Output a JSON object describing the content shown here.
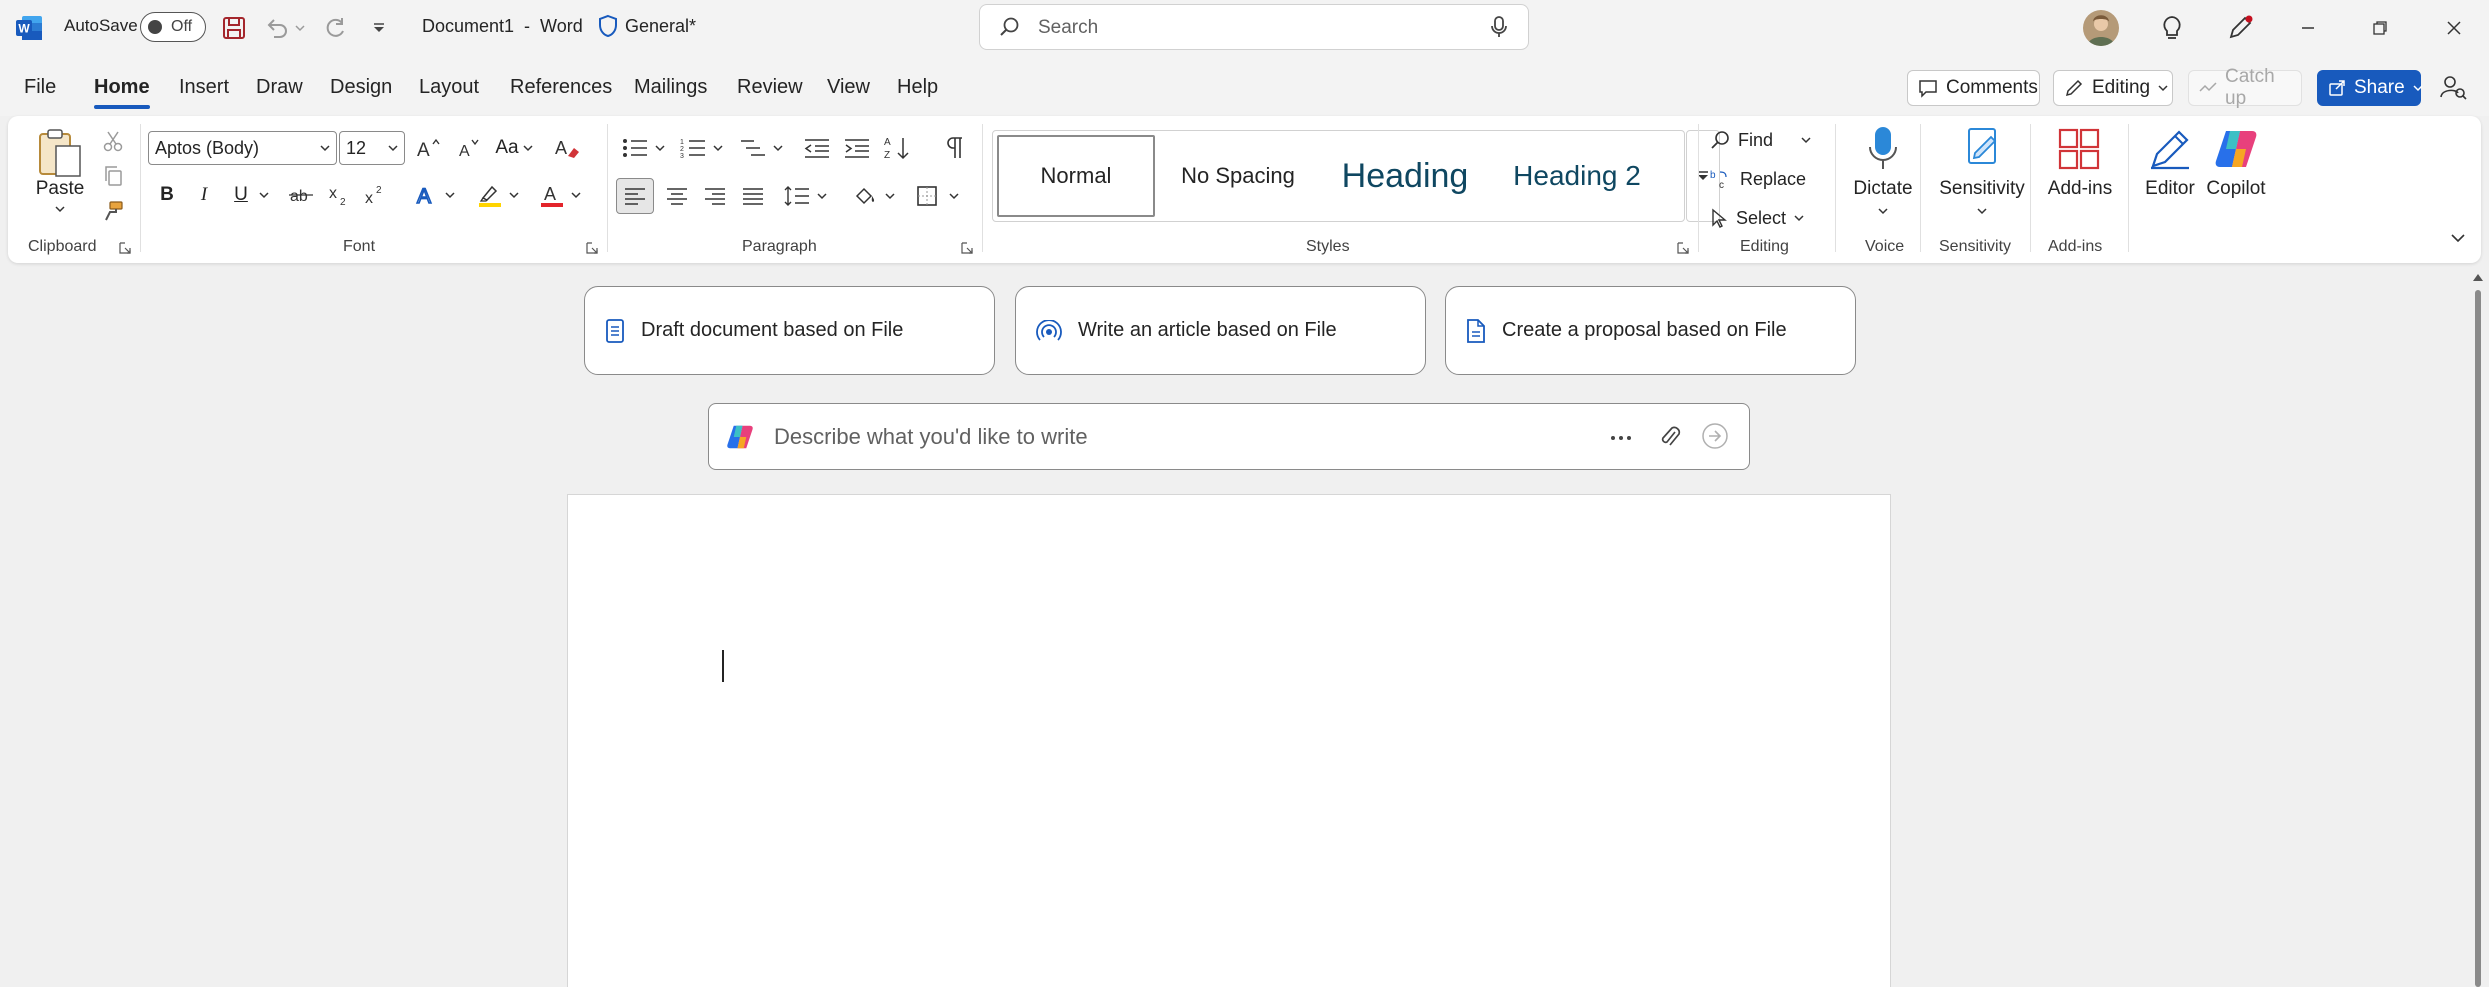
{
  "titlebar": {
    "autosave_label": "AutoSave",
    "autosave_state": "Off",
    "document_title": "Document1  -  Word",
    "sensitivity_label": "General*",
    "search_placeholder": "Search"
  },
  "tabs": {
    "file": "File",
    "home": "Home",
    "insert": "Insert",
    "draw": "Draw",
    "design": "Design",
    "layout": "Layout",
    "references": "References",
    "mailings": "Mailings",
    "review": "Review",
    "view": "View",
    "help": "Help"
  },
  "right_actions": {
    "comments": "Comments",
    "editing": "Editing",
    "catch_up": "Catch up",
    "share": "Share"
  },
  "ribbon": {
    "clipboard": {
      "paste": "Paste",
      "group": "Clipboard"
    },
    "font": {
      "name": "Aptos (Body)",
      "size": "12",
      "change_case": "Aa",
      "bold": "B",
      "italic": "I",
      "underline": "U",
      "group": "Font"
    },
    "paragraph": {
      "group": "Paragraph"
    },
    "styles": {
      "items": [
        "Normal",
        "No Spacing",
        "Heading",
        "Heading 2"
      ],
      "group": "Styles"
    },
    "editing": {
      "find": "Find",
      "replace": "Replace",
      "select": "Select",
      "group": "Editing"
    },
    "voice": {
      "dictate": "Dictate",
      "group": "Voice"
    },
    "sensitivity": {
      "label": "Sensitivity",
      "group": "Sensitivity"
    },
    "addins": {
      "label": "Add-ins",
      "group": "Add-ins"
    },
    "editor": "Editor",
    "copilot": "Copilot"
  },
  "copilot_suggestions": [
    "Draft document based on File",
    "Write an article based on File",
    "Create a proposal based on File"
  ],
  "copilot_prompt": {
    "placeholder": "Describe what you'd like to write"
  },
  "colors": {
    "accent": "#185abd",
    "highlight": "#ffd400",
    "font_color": "#e3242b"
  }
}
